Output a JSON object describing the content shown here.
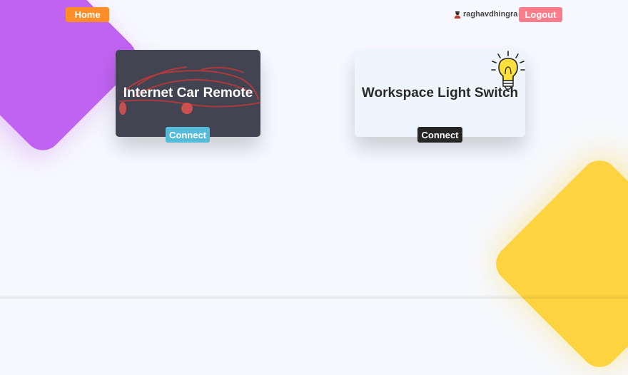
{
  "nav": {
    "home_label": "Home",
    "username": "raghavdhingra",
    "logout_label": "Logout"
  },
  "cards": [
    {
      "title": "Internet Car Remote",
      "connect_label": "Connect"
    },
    {
      "title": "Workspace Light Switch",
      "connect_label": "Connect"
    }
  ],
  "colors": {
    "background": "#f7f9fe",
    "home_button": "#fe8d2a",
    "logout_button": "#fd7c8b",
    "purple_shape": "#c163f2",
    "yellow_shape": "#fdd33f",
    "car_card": "#434451",
    "light_card": "#eef5fd",
    "car_connect": "#54bbd9",
    "light_connect": "#262626"
  },
  "icons": {
    "user": "user-avatar-icon",
    "car": "car-outline-icon",
    "bulb": "light-bulb-icon"
  }
}
